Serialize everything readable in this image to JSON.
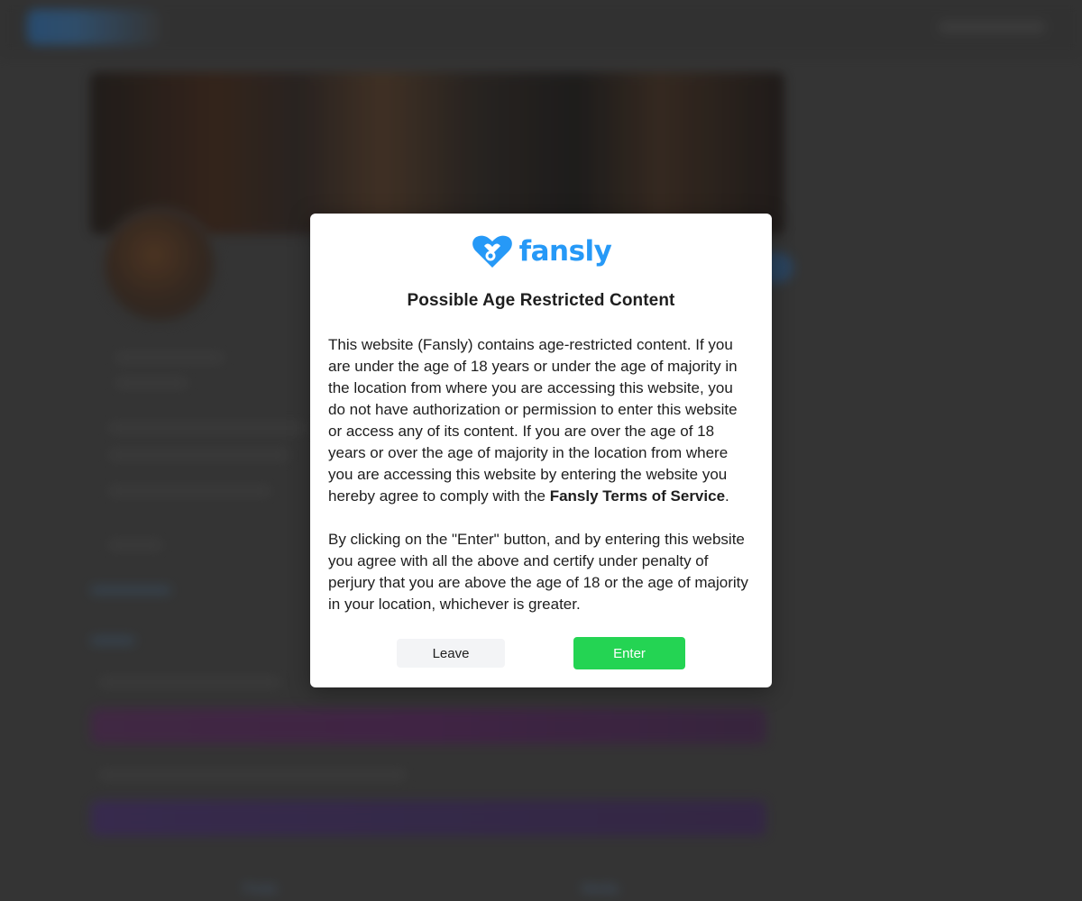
{
  "background": {
    "tabs": [
      "Posts",
      "Media"
    ]
  },
  "modal": {
    "logo_text": "fansly",
    "logo_icon": "fansly-heart-icon",
    "title": "Possible Age Restricted Content",
    "paragraph1_before_link": "This website (Fansly) contains age-restricted content. If you are under the age of 18 years or under the age of majority in the location from where you are accessing this website, you do not have authorization or permission to enter this website or access any of its content. If you are over the age of 18 years or over the age of majority in the location from where you are accessing this website by entering the website you hereby agree to comply with the ",
    "tos_link": "Fansly Terms of Service",
    "paragraph1_after_link": ".",
    "paragraph2": "By clicking on the \"Enter\" button, and by entering this website you agree with all the above and certify under penalty of perjury that you are above the age of 18 or the age of majority in your location, whichever is greater.",
    "leave_label": "Leave",
    "enter_label": "Enter"
  },
  "colors": {
    "brand": "#2699f7",
    "enter": "#24d453",
    "leave_bg": "#f3f4f6",
    "backdrop": "#3a3a3a"
  }
}
